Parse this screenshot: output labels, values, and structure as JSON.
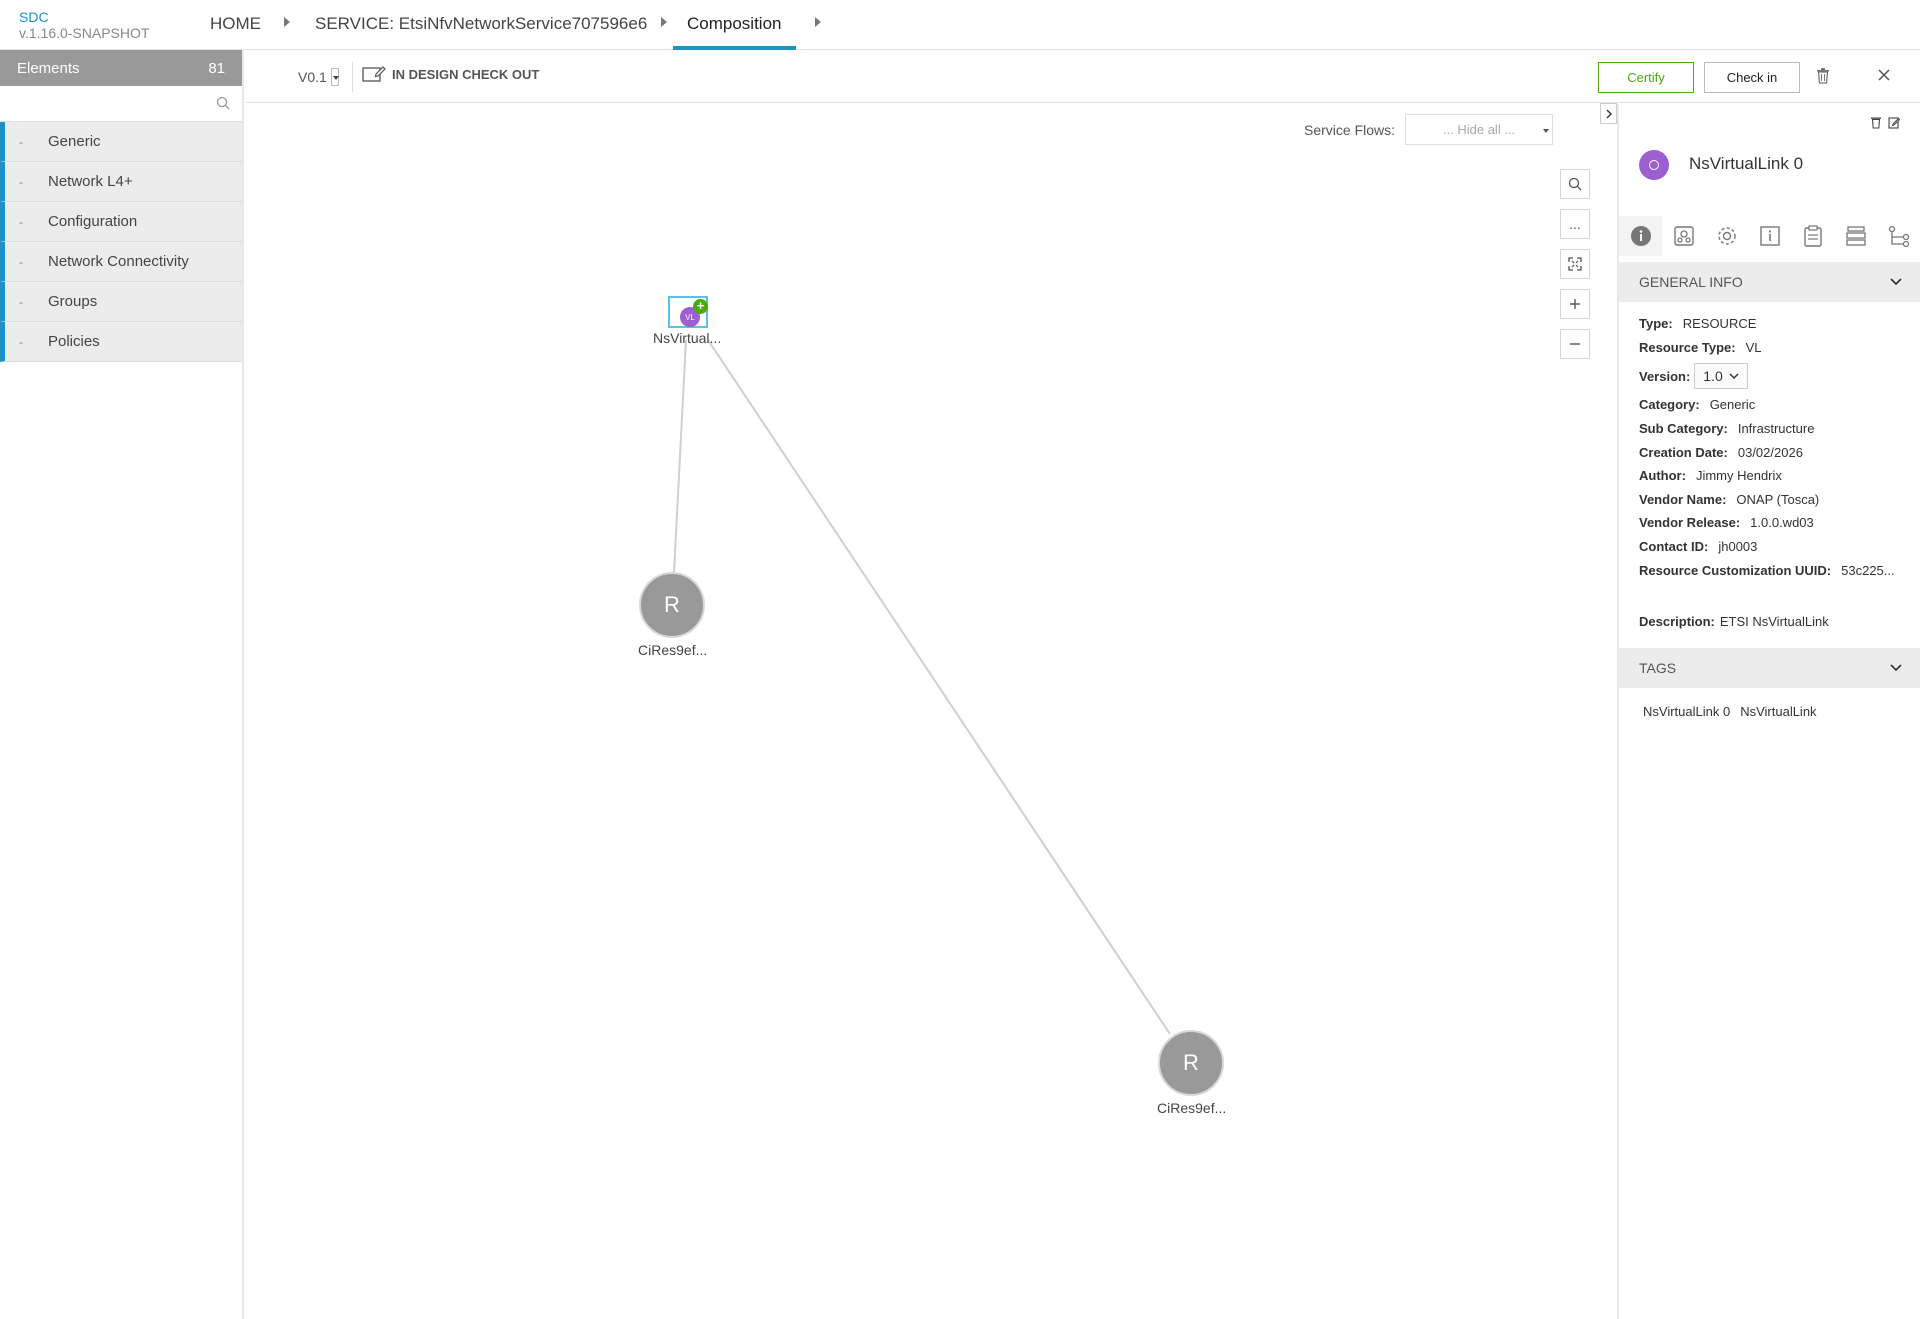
{
  "brand": {
    "name": "SDC",
    "version": "v.1.16.0-SNAPSHOT"
  },
  "breadcrumb": {
    "home": "HOME",
    "service": "SERVICE: EtsiNfvNetworkService707596e6",
    "current": "Composition"
  },
  "elements_panel": {
    "title": "Elements",
    "count": "81",
    "search_placeholder": "",
    "categories": [
      "Generic",
      "Network L4+",
      "Configuration",
      "Network Connectivity",
      "Groups",
      "Policies"
    ]
  },
  "toolbar": {
    "version": "V0.1",
    "status": "IN DESIGN CHECK OUT",
    "certify_label": "Certify",
    "checkin_label": "Check in"
  },
  "canvas": {
    "service_flows_label": "Service Flows:",
    "service_flows_value": "... Hide all ...",
    "nodes": {
      "vl": {
        "badge": "VL",
        "plus": "+",
        "label": "NsVirtual..."
      },
      "r1": {
        "letter": "R",
        "label": "CiRes9ef..."
      },
      "r2": {
        "letter": "R",
        "label": "CiRes9ef..."
      }
    },
    "controls": {
      "more": "..."
    }
  },
  "details": {
    "title": "NsVirtualLink 0",
    "general_info_title": "GENERAL INFO",
    "tags_title": "TAGS",
    "fields": {
      "type_k": "Type:",
      "type_v": "RESOURCE",
      "rtype_k": "Resource Type:",
      "rtype_v": "VL",
      "version_k": "Version:",
      "version_v": "1.0",
      "cat_k": "Category:",
      "cat_v": "Generic",
      "subcat_k": "Sub Category:",
      "subcat_v": "Infrastructure",
      "cdate_k": "Creation Date:",
      "cdate_v": "03/02/2026",
      "author_k": "Author:",
      "author_v": "Jimmy Hendrix",
      "vendor_k": "Vendor Name:",
      "vendor_v": "ONAP (Tosca)",
      "vrel_k": "Vendor Release:",
      "vrel_v": "1.0.0.wd03",
      "contact_k": "Contact ID:",
      "contact_v": "jh0003",
      "uuid_k": "Resource Customization UUID:",
      "uuid_v": "53c225...",
      "desc_k": "Description:",
      "desc_v": "ETSI NsVirtualLink"
    },
    "tags": [
      "NsVirtualLink 0",
      "NsVirtualLink"
    ]
  },
  "colors": {
    "accent": "#1d92c5",
    "certify": "#4ca90c",
    "vl_node": "#9b5fcf",
    "resource_node": "#999999"
  }
}
